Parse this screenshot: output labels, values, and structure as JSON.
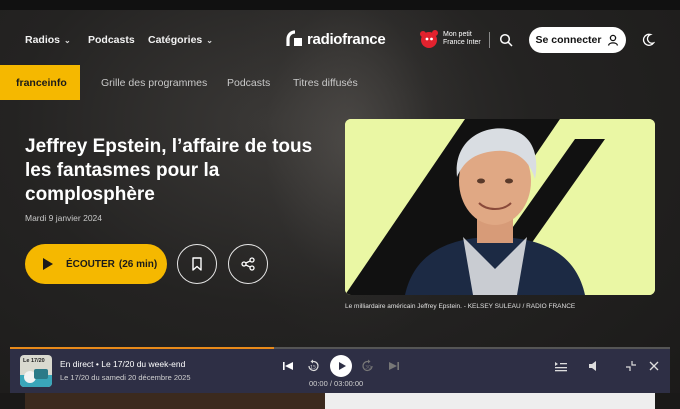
{
  "header": {
    "nav": [
      {
        "label": "Radios",
        "has_dropdown": true
      },
      {
        "label": "Podcasts",
        "has_dropdown": false
      },
      {
        "label": "Catégories",
        "has_dropdown": true
      }
    ],
    "logo_text": "radiofrance",
    "kids_brand": "Mon petit France Inter",
    "login_label": "Se connecter",
    "icons": [
      "search-icon",
      "user-icon",
      "moon-icon"
    ]
  },
  "subnav": {
    "station": "franceinfo",
    "links": [
      "Grille des programmes",
      "Podcasts",
      "Titres diffusés"
    ]
  },
  "article": {
    "title": "Jeffrey Epstein, l’affaire de tous les fantasmes pour la complosphère",
    "date": "Mardi 9 janvier 2024",
    "listen_label": "ÉCOUTER",
    "duration": "(26 min)",
    "image_caption": "Le milliardaire américain Jeffrey Epstein. - KELSEY SULEAU / RADIO FRANCE"
  },
  "player": {
    "thumb_label": "Le 17/20",
    "live_line": "En direct • Le 17/20 du week-end",
    "sub_line": "Le 17/20 du samedi 20 décembre 2025",
    "time": "00:00 / 03:00:00",
    "progress": 0.4
  },
  "colors": {
    "accent": "#f5b800",
    "player_bg": "#2e2f45",
    "image_bg": "#eaf7a4",
    "progress": "#e88a1a"
  }
}
